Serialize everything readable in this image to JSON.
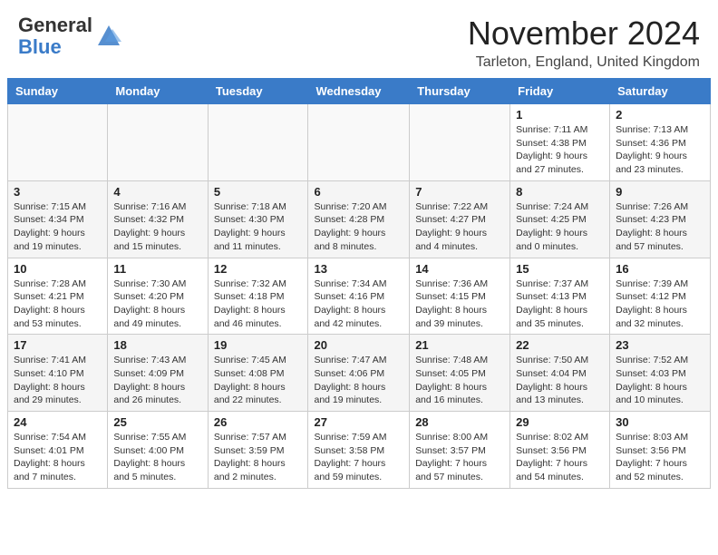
{
  "header": {
    "logo_general": "General",
    "logo_blue": "Blue",
    "month_title": "November 2024",
    "location": "Tarleton, England, United Kingdom"
  },
  "weekdays": [
    "Sunday",
    "Monday",
    "Tuesday",
    "Wednesday",
    "Thursday",
    "Friday",
    "Saturday"
  ],
  "weeks": [
    [
      {
        "day": "",
        "info": ""
      },
      {
        "day": "",
        "info": ""
      },
      {
        "day": "",
        "info": ""
      },
      {
        "day": "",
        "info": ""
      },
      {
        "day": "",
        "info": ""
      },
      {
        "day": "1",
        "info": "Sunrise: 7:11 AM\nSunset: 4:38 PM\nDaylight: 9 hours\nand 27 minutes."
      },
      {
        "day": "2",
        "info": "Sunrise: 7:13 AM\nSunset: 4:36 PM\nDaylight: 9 hours\nand 23 minutes."
      }
    ],
    [
      {
        "day": "3",
        "info": "Sunrise: 7:15 AM\nSunset: 4:34 PM\nDaylight: 9 hours\nand 19 minutes."
      },
      {
        "day": "4",
        "info": "Sunrise: 7:16 AM\nSunset: 4:32 PM\nDaylight: 9 hours\nand 15 minutes."
      },
      {
        "day": "5",
        "info": "Sunrise: 7:18 AM\nSunset: 4:30 PM\nDaylight: 9 hours\nand 11 minutes."
      },
      {
        "day": "6",
        "info": "Sunrise: 7:20 AM\nSunset: 4:28 PM\nDaylight: 9 hours\nand 8 minutes."
      },
      {
        "day": "7",
        "info": "Sunrise: 7:22 AM\nSunset: 4:27 PM\nDaylight: 9 hours\nand 4 minutes."
      },
      {
        "day": "8",
        "info": "Sunrise: 7:24 AM\nSunset: 4:25 PM\nDaylight: 9 hours\nand 0 minutes."
      },
      {
        "day": "9",
        "info": "Sunrise: 7:26 AM\nSunset: 4:23 PM\nDaylight: 8 hours\nand 57 minutes."
      }
    ],
    [
      {
        "day": "10",
        "info": "Sunrise: 7:28 AM\nSunset: 4:21 PM\nDaylight: 8 hours\nand 53 minutes."
      },
      {
        "day": "11",
        "info": "Sunrise: 7:30 AM\nSunset: 4:20 PM\nDaylight: 8 hours\nand 49 minutes."
      },
      {
        "day": "12",
        "info": "Sunrise: 7:32 AM\nSunset: 4:18 PM\nDaylight: 8 hours\nand 46 minutes."
      },
      {
        "day": "13",
        "info": "Sunrise: 7:34 AM\nSunset: 4:16 PM\nDaylight: 8 hours\nand 42 minutes."
      },
      {
        "day": "14",
        "info": "Sunrise: 7:36 AM\nSunset: 4:15 PM\nDaylight: 8 hours\nand 39 minutes."
      },
      {
        "day": "15",
        "info": "Sunrise: 7:37 AM\nSunset: 4:13 PM\nDaylight: 8 hours\nand 35 minutes."
      },
      {
        "day": "16",
        "info": "Sunrise: 7:39 AM\nSunset: 4:12 PM\nDaylight: 8 hours\nand 32 minutes."
      }
    ],
    [
      {
        "day": "17",
        "info": "Sunrise: 7:41 AM\nSunset: 4:10 PM\nDaylight: 8 hours\nand 29 minutes."
      },
      {
        "day": "18",
        "info": "Sunrise: 7:43 AM\nSunset: 4:09 PM\nDaylight: 8 hours\nand 26 minutes."
      },
      {
        "day": "19",
        "info": "Sunrise: 7:45 AM\nSunset: 4:08 PM\nDaylight: 8 hours\nand 22 minutes."
      },
      {
        "day": "20",
        "info": "Sunrise: 7:47 AM\nSunset: 4:06 PM\nDaylight: 8 hours\nand 19 minutes."
      },
      {
        "day": "21",
        "info": "Sunrise: 7:48 AM\nSunset: 4:05 PM\nDaylight: 8 hours\nand 16 minutes."
      },
      {
        "day": "22",
        "info": "Sunrise: 7:50 AM\nSunset: 4:04 PM\nDaylight: 8 hours\nand 13 minutes."
      },
      {
        "day": "23",
        "info": "Sunrise: 7:52 AM\nSunset: 4:03 PM\nDaylight: 8 hours\nand 10 minutes."
      }
    ],
    [
      {
        "day": "24",
        "info": "Sunrise: 7:54 AM\nSunset: 4:01 PM\nDaylight: 8 hours\nand 7 minutes."
      },
      {
        "day": "25",
        "info": "Sunrise: 7:55 AM\nSunset: 4:00 PM\nDaylight: 8 hours\nand 5 minutes."
      },
      {
        "day": "26",
        "info": "Sunrise: 7:57 AM\nSunset: 3:59 PM\nDaylight: 8 hours\nand 2 minutes."
      },
      {
        "day": "27",
        "info": "Sunrise: 7:59 AM\nSunset: 3:58 PM\nDaylight: 7 hours\nand 59 minutes."
      },
      {
        "day": "28",
        "info": "Sunrise: 8:00 AM\nSunset: 3:57 PM\nDaylight: 7 hours\nand 57 minutes."
      },
      {
        "day": "29",
        "info": "Sunrise: 8:02 AM\nSunset: 3:56 PM\nDaylight: 7 hours\nand 54 minutes."
      },
      {
        "day": "30",
        "info": "Sunrise: 8:03 AM\nSunset: 3:56 PM\nDaylight: 7 hours\nand 52 minutes."
      }
    ]
  ]
}
